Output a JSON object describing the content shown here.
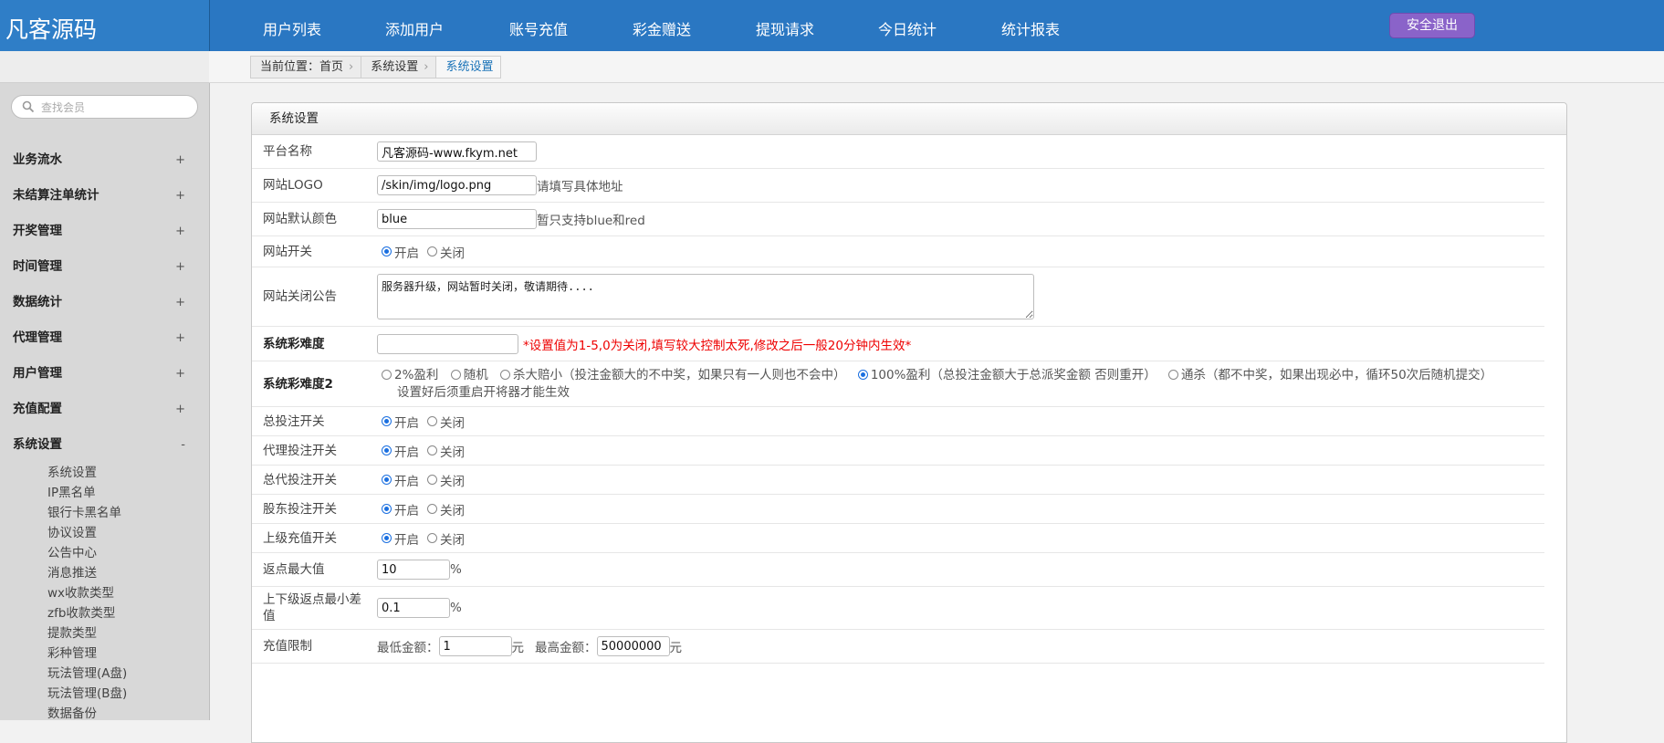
{
  "header": {
    "logo": "凡客源码",
    "nav": [
      "用户列表",
      "添加用户",
      "账号充值",
      "彩金赠送",
      "提现请求",
      "今日统计",
      "统计报表"
    ],
    "logout": "安全退出"
  },
  "breadcrumb": [
    "当前位置：首页",
    "系统设置",
    "系统设置"
  ],
  "sidebar": {
    "search_placeholder": "查找会员",
    "groups": [
      {
        "label": "业务流水",
        "toggle": "+"
      },
      {
        "label": "未结算注单统计",
        "toggle": "+"
      },
      {
        "label": "开奖管理",
        "toggle": "+"
      },
      {
        "label": "时间管理",
        "toggle": "+"
      },
      {
        "label": "数据统计",
        "toggle": "+"
      },
      {
        "label": "代理管理",
        "toggle": "+"
      },
      {
        "label": "用户管理",
        "toggle": "+"
      },
      {
        "label": "充值配置",
        "toggle": "+"
      },
      {
        "label": "系统设置",
        "toggle": "-"
      }
    ],
    "sub_items": [
      "系统设置",
      "IP黑名单",
      "银行卡黑名单",
      "协议设置",
      "公告中心",
      "消息推送",
      "wx收款类型",
      "zfb收款类型",
      "提款类型",
      "彩种管理",
      "玩法管理(A盘)",
      "玩法管理(B盘)",
      "数据备份"
    ]
  },
  "panel": {
    "title": "系统设置",
    "rows": {
      "platform_name": {
        "label": "平台名称",
        "value": "凡客源码-www.fkym.net"
      },
      "logo": {
        "label": "网站LOGO",
        "value": "/skin/img/logo.png",
        "hint": "请填写具体地址"
      },
      "color": {
        "label": "网站默认颜色",
        "value": "blue",
        "hint": "暂只支持blue和red"
      },
      "site_switch": {
        "label": "网站开关",
        "on": "开启",
        "off": "关闭"
      },
      "close_notice": {
        "label": "网站关闭公告",
        "value": "服务器升级，网站暂时关闭，敬请期待...."
      },
      "difficulty": {
        "label": "系统彩难度",
        "value": "",
        "hint": "*设置值为1-5,0为关闭,填写较大控制太死,修改之后一般20分钟内生效*"
      },
      "difficulty2": {
        "label": "系统彩难度2",
        "options": [
          "2%盈利",
          "随机",
          "杀大赔小（投注金额大的不中奖，如果只有一人则也不会中）",
          "100%盈利（总投注金额大于总派奖金额 否则重开）",
          "通杀（都不中奖，如果出现必中，循环50次后随机提交）"
        ],
        "selected_index": 3,
        "hint": "设置好后须重启开将器才能生效"
      },
      "total_bet": {
        "label": "总投注开关",
        "on": "开启",
        "off": "关闭"
      },
      "agent_bet": {
        "label": "代理投注开关",
        "on": "开启",
        "off": "关闭"
      },
      "general_agent_bet": {
        "label": "总代投注开关",
        "on": "开启",
        "off": "关闭"
      },
      "shareholder_bet": {
        "label": "股东投注开关",
        "on": "开启",
        "off": "关闭"
      },
      "upper_recharge": {
        "label": "上级充值开关",
        "on": "开启",
        "off": "关闭"
      },
      "rebate_max": {
        "label": "返点最大值",
        "value": "10",
        "unit": "%"
      },
      "rebate_min_diff": {
        "label": "上下级返点最小差值",
        "value": "0.1",
        "unit": "%"
      },
      "recharge_limit": {
        "label": "充值限制",
        "min_label": "最低金额：",
        "min_value": "1",
        "min_unit": "元",
        "max_label": "最高金额：",
        "max_value": "50000000",
        "max_unit": "元"
      }
    }
  }
}
